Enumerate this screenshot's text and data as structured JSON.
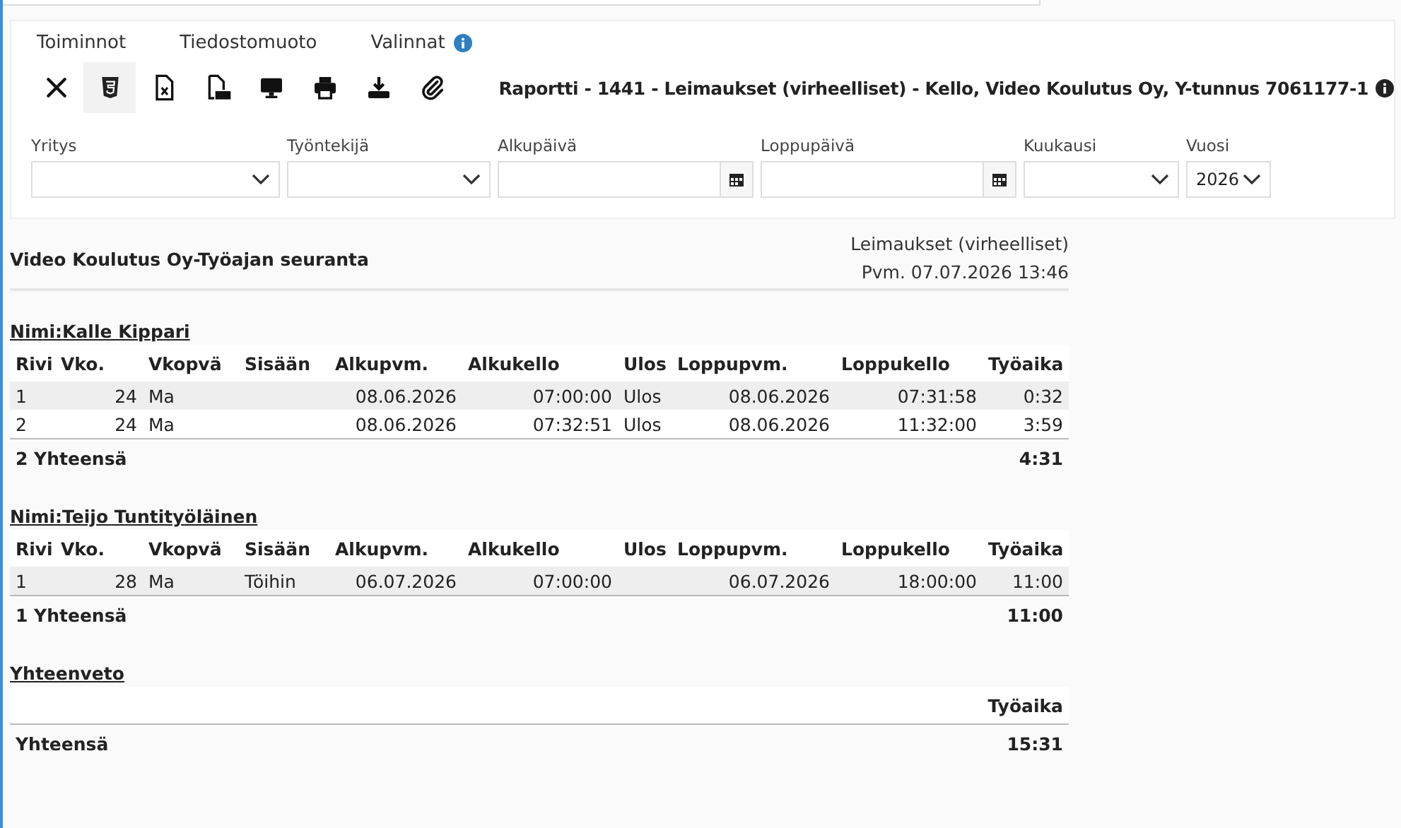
{
  "tabs": [
    {
      "label": "Toiminnot",
      "info": false
    },
    {
      "label": "Tiedostomuoto",
      "info": false
    },
    {
      "label": "Valinnat",
      "info": true
    }
  ],
  "toolbar": [
    {
      "kind": "close",
      "selected": false
    },
    {
      "kind": "html5",
      "selected": true
    },
    {
      "kind": "excel",
      "selected": false
    },
    {
      "kind": "pdf",
      "selected": false
    },
    {
      "kind": "screen",
      "selected": false
    },
    {
      "kind": "print",
      "selected": false
    },
    {
      "kind": "download",
      "selected": false
    },
    {
      "kind": "attach",
      "selected": false
    }
  ],
  "report_title": "Raportti - 1441 - Leimaukset (virheelliset) - Kello, Video Koulutus Oy, Y-tunnus 7061177-1",
  "filters": [
    {
      "label": "Yritys",
      "kind": "select"
    },
    {
      "label": "Työntekijä",
      "kind": "select"
    },
    {
      "label": "Alkupäivä",
      "kind": "date"
    },
    {
      "label": "Loppupäivä",
      "kind": "date"
    },
    {
      "label": "Kuukausi",
      "kind": "select"
    },
    {
      "label": "Vuosi",
      "kind": "select",
      "value": "2026"
    }
  ],
  "report": {
    "title": "Video Koulutus Oy-Työajan seuranta",
    "info_lines": [
      "Leimaukset (virheelliset)",
      "Pvm. 07.07.2026 13:46"
    ]
  },
  "groups": [
    {
      "name": "Nimi:Kalle Kippari",
      "columns": [
        "Rivi",
        "Vko.",
        "Vkopvä",
        "Sisään",
        "Alkupvm.",
        "Alkukello",
        "Ulos",
        "Loppupvm.",
        "Loppukello",
        "Työaika"
      ],
      "rows": [
        [
          "1",
          "24",
          "Ma",
          "",
          "08.06.2026",
          "07:00:00",
          "Ulos",
          "08.06.2026",
          "07:31:58",
          "0:32"
        ],
        [
          "2",
          "24",
          "Ma",
          "",
          "08.06.2026",
          "07:32:51",
          "Ulos",
          "08.06.2026",
          "11:32:00",
          "3:59"
        ]
      ],
      "total_label": "2 Yhteensä",
      "total_value": "4:31"
    },
    {
      "name": "Nimi:Teijo Tuntityöläinen",
      "columns": [
        "Rivi",
        "Vko.",
        "Vkopvä",
        "Sisään",
        "Alkupvm.",
        "Alkukello",
        "Ulos",
        "Loppupvm.",
        "Loppukello",
        "Työaika"
      ],
      "rows": [
        [
          "1",
          "28",
          "Ma",
          "Töihin",
          "06.07.2026",
          "07:00:00",
          "",
          "06.07.2026",
          "18:00:00",
          "11:00"
        ]
      ],
      "total_label": "1 Yhteensä",
      "total_value": "11:00"
    }
  ],
  "summary": {
    "title": "Yhteenveto",
    "column": "Työaika",
    "total_label": "Yhteensä",
    "total_value": "15:31"
  }
}
